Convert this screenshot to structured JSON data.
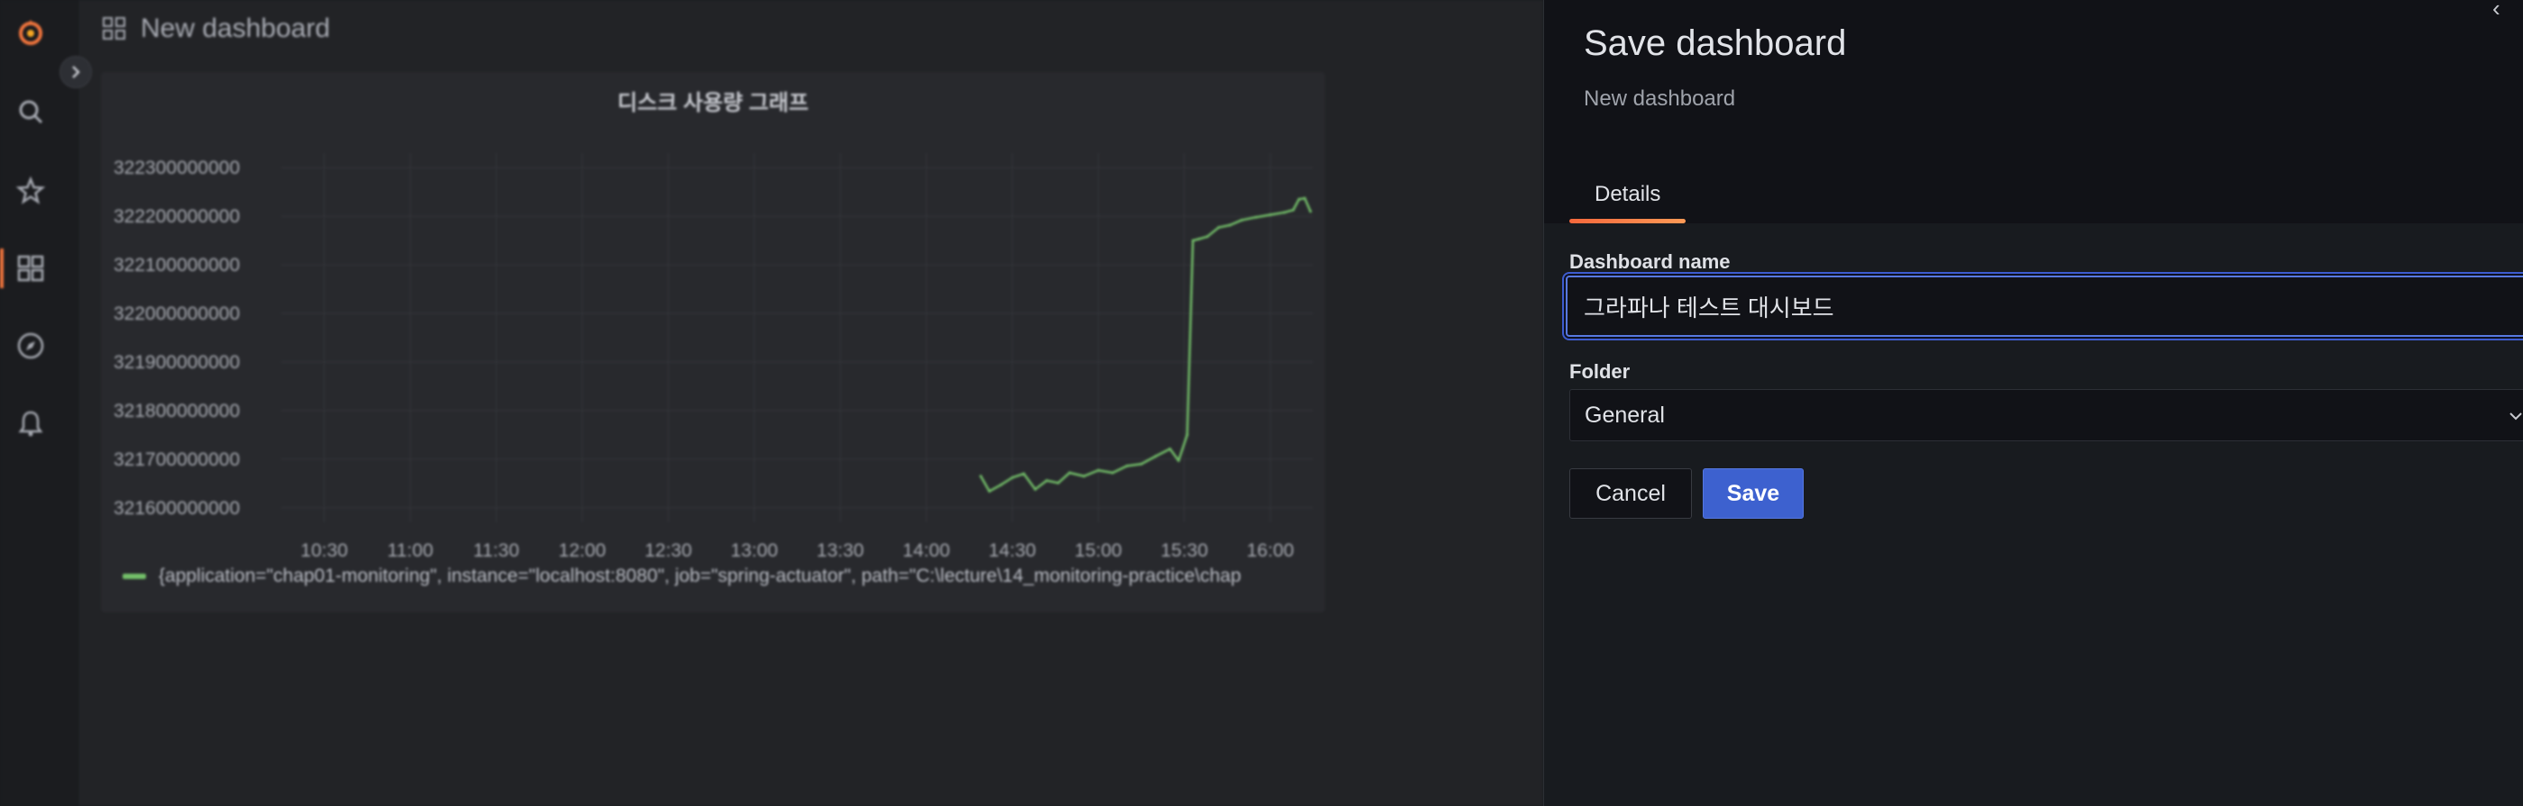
{
  "app": {
    "dashboard_title": "New dashboard",
    "nav_icons": [
      "grafana-logo-icon",
      "search-icon",
      "star-icon",
      "dashboards-icon",
      "explore-compass-icon",
      "alerting-bell-icon"
    ],
    "panel": {
      "title": "디스크 사용량 그래프",
      "legend": "{application=\"chap01-monitoring\", instance=\"localhost:8080\", job=\"spring-actuator\", path=\"C:\\lecture\\14_monitoring-practice\\chap"
    }
  },
  "chart_data": {
    "type": "line",
    "title": "디스크 사용량 그래프",
    "xlabel": "",
    "ylabel": "",
    "x_ticks": [
      "10:30",
      "11:00",
      "11:30",
      "12:00",
      "12:30",
      "13:00",
      "13:30",
      "14:00",
      "14:30",
      "15:00",
      "15:30",
      "16:00"
    ],
    "y_ticks": [
      "322300000000",
      "322200000000",
      "322100000000",
      "322000000000",
      "321900000000",
      "321800000000",
      "321700000000",
      "321600000000"
    ],
    "y_ticks_shown": [
      "322300000000",
      "322200000000",
      "322100000000",
      "322000000000",
      "321900000000",
      "321800000000",
      "321700000000",
      "321600000000"
    ],
    "xlim": [
      "10:15",
      "16:15"
    ],
    "ylim": [
      321570000000,
      322330000000
    ],
    "grid": true,
    "series": [
      {
        "name": "{application=\"chap01-monitoring\", instance=\"localhost:8080\", job=\"spring-actuator\", path=\"C:\\lecture\\14_monitoring-practice\\chap",
        "color": "#73bf69",
        "x": [
          "14:19",
          "14:22",
          "14:26",
          "14:30",
          "14:34",
          "14:38",
          "14:42",
          "14:46",
          "14:50",
          "14:55",
          "15:00",
          "15:05",
          "15:10",
          "15:15",
          "15:20",
          "15:25",
          "15:28",
          "15:31",
          "15:33",
          "15:35",
          "15:38",
          "15:42",
          "15:46",
          "15:50",
          "15:55",
          "16:00",
          "16:05",
          "16:08",
          "16:10",
          "16:12",
          "16:14"
        ],
        "values": [
          321665000000,
          321634000000,
          321647000000,
          321662000000,
          321670000000,
          321638000000,
          321656000000,
          321651000000,
          321672000000,
          321665000000,
          321677000000,
          321672000000,
          321686000000,
          321690000000,
          321706000000,
          321721000000,
          321697000000,
          321750000000,
          322150000000,
          322153000000,
          322158000000,
          322177000000,
          322182000000,
          322192000000,
          322198000000,
          322203000000,
          322208000000,
          322213000000,
          322235000000,
          322237000000,
          322210000000
        ]
      }
    ]
  },
  "drawer": {
    "title": "Save dashboard",
    "subtitle": "New dashboard",
    "close_label": "‹",
    "tab_label": "Details",
    "name_label": "Dashboard name",
    "name_value": "그라파나 테스트 대시보드",
    "folder_label": "Folder",
    "folder_value": "General",
    "cancel_label": "Cancel",
    "save_label": "Save"
  }
}
